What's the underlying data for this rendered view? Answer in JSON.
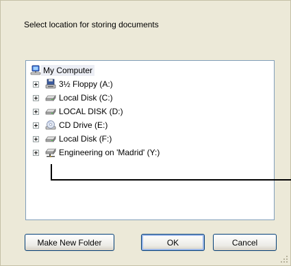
{
  "dialog": {
    "prompt": "Select location for storing documents"
  },
  "tree": {
    "root": {
      "label": "My Computer",
      "icon": "my-computer-icon"
    },
    "items": [
      {
        "label": "3½ Floppy (A:)",
        "icon": "floppy-drive-icon"
      },
      {
        "label": "Local Disk (C:)",
        "icon": "hard-disk-icon"
      },
      {
        "label": "LOCAL DISK (D:)",
        "icon": "hard-disk-icon"
      },
      {
        "label": "CD Drive (E:)",
        "icon": "cd-drive-icon"
      },
      {
        "label": "Local Disk (F:)",
        "icon": "hard-disk-icon"
      },
      {
        "label": "Engineering on 'Madrid' (Y:)",
        "icon": "network-drive-icon"
      }
    ]
  },
  "buttons": {
    "make_new_folder": "Make New Folder",
    "ok": "OK",
    "cancel": "Cancel"
  },
  "colors": {
    "dialog_bg": "#ece9d8",
    "tree_border": "#7f9db9",
    "button_border": "#003c74"
  }
}
